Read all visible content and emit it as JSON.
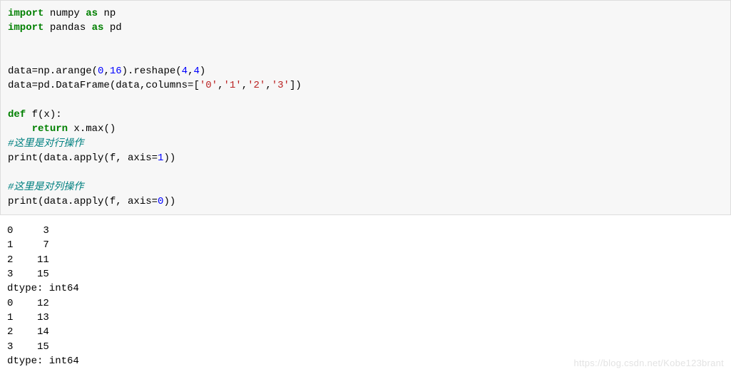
{
  "code": {
    "l1_kw1": "import",
    "l1_txt1": " numpy ",
    "l1_kw2": "as",
    "l1_txt2": " np",
    "l2_kw1": "import",
    "l2_txt1": " pandas ",
    "l2_kw2": "as",
    "l2_txt2": " pd",
    "l5_a": "data=np.arange(",
    "l5_n1": "0",
    "l5_b": ",",
    "l5_n2": "16",
    "l5_c": ").reshape(",
    "l5_n3": "4",
    "l5_d": ",",
    "l5_n4": "4",
    "l5_e": ")",
    "l6_a": "data=pd.DataFrame(data,columns=[",
    "l6_s1": "'0'",
    "l6_b": ",",
    "l6_s2": "'1'",
    "l6_c": ",",
    "l6_s3": "'2'",
    "l6_d": ",",
    "l6_s4": "'3'",
    "l6_e": "])",
    "l8_kw": "def",
    "l8_txt": " f(x):",
    "l9_ind": "    ",
    "l9_kw": "return",
    "l9_txt": " x.max()",
    "l10_cmnt": "#这里是对行操作",
    "l11_a": "print(data.apply(f, axis=",
    "l11_n": "1",
    "l11_b": "))",
    "l13_cmnt": "#这里是对列操作",
    "l14_a": "print(data.apply(f, axis=",
    "l14_n": "0",
    "l14_b": "))"
  },
  "output": "0     3\n1     7\n2    11\n3    15\ndtype: int64\n0    12\n1    13\n2    14\n3    15\ndtype: int64",
  "watermark": "https://blog.csdn.net/Kobe123brant"
}
